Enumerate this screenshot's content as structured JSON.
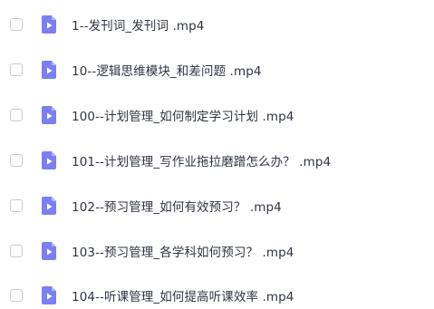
{
  "files": [
    {
      "name": "1--发刊词_发刊词 .mp4",
      "type": "video-file-icon",
      "checked": false
    },
    {
      "name": "10--逻辑思维模块_和差问题 .mp4",
      "type": "video-file-icon",
      "checked": false
    },
    {
      "name": "100--计划管理_如何制定学习计划 .mp4",
      "type": "video-file-icon",
      "checked": false
    },
    {
      "name": "101--计划管理_写作业拖拉磨蹭怎么办？ .mp4",
      "type": "video-file-icon",
      "checked": false
    },
    {
      "name": "102--预习管理_如何有效预习？ .mp4",
      "type": "video-file-icon",
      "checked": false
    },
    {
      "name": "103--预习管理_各学科如何预习？ .mp4",
      "type": "video-file-icon",
      "checked": false
    },
    {
      "name": "104--听课管理_如何提高听课效率 .mp4",
      "type": "video-file-icon",
      "checked": false
    }
  ],
  "colors": {
    "icon_primary": "#7b7ff2",
    "icon_fold": "#b3b6f8",
    "checkbox_border": "#c9ccd3",
    "text": "#2f3542"
  }
}
